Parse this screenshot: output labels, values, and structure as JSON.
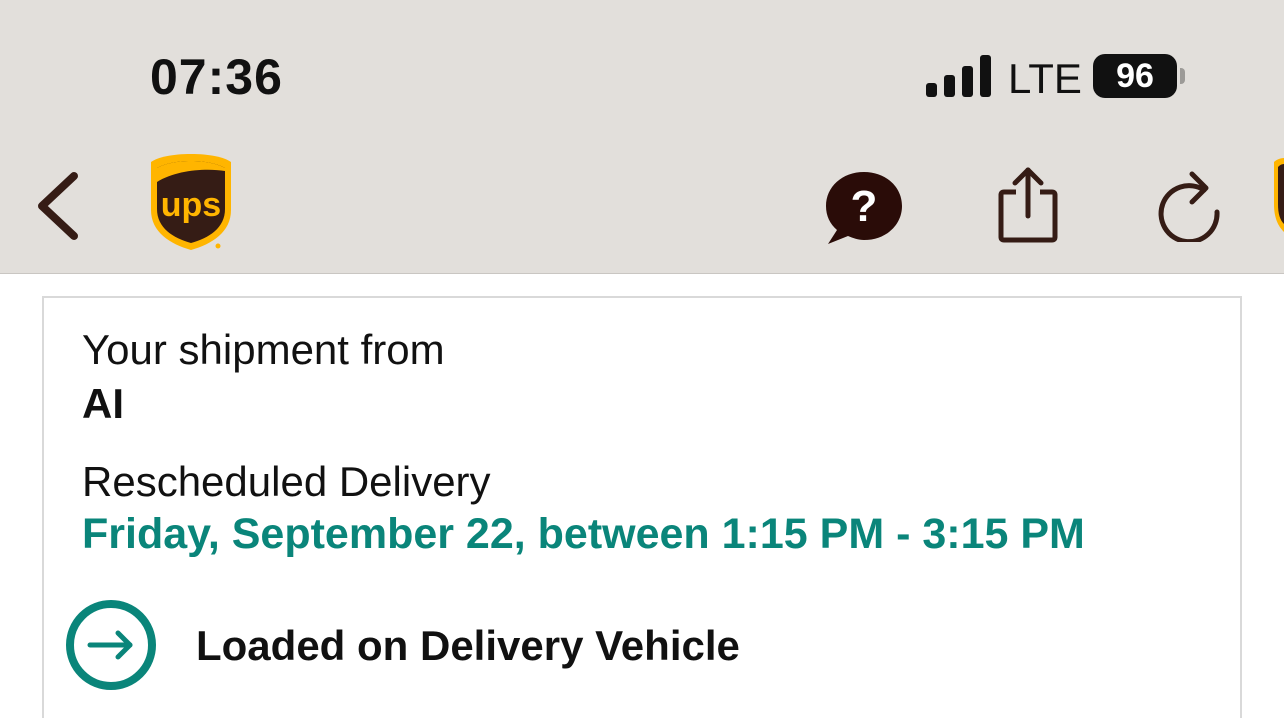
{
  "status_bar": {
    "time": "07:36",
    "network": "LTE",
    "battery": "96"
  },
  "header": {
    "back_icon": "chevron-left-icon",
    "logo": "ups",
    "actions": [
      {
        "icon": "help-icon",
        "label": "?"
      },
      {
        "icon": "share-icon"
      },
      {
        "icon": "refresh-icon"
      }
    ]
  },
  "shipment": {
    "from_label": "Your shipment from",
    "from_name": "AI",
    "status_label": "Rescheduled Delivery",
    "status_date": "Friday, September 22, between 1:15 PM - 3:15 PM",
    "progress_icon": "arrow-right-circle-icon",
    "progress_text": "Loaded on Delivery Vehicle"
  },
  "colors": {
    "header_bg": "#e2dfdb",
    "brand_brown": "#351c15",
    "brand_gold": "#ffb500",
    "accent_teal": "#0a857a"
  }
}
